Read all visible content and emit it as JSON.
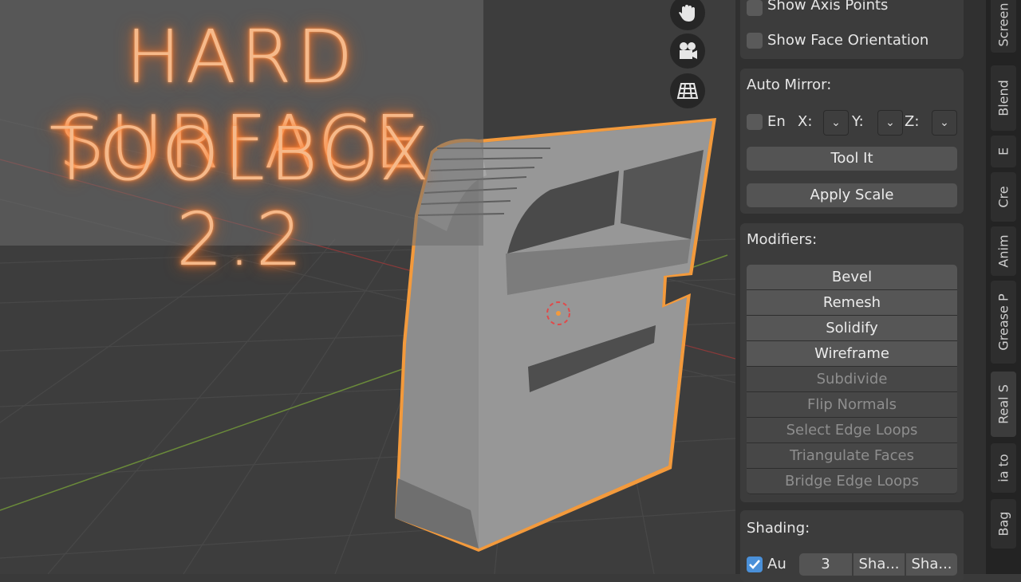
{
  "banner": {
    "line1": "HARD SURFACE",
    "line2": "TOOLBOX 2.2"
  },
  "viewport_icons": [
    "hand-icon",
    "camera-icon",
    "grid-icon"
  ],
  "overlays_panel": {
    "show_axis_points": "Show Axis Points",
    "show_face_orientation": "Show Face Orientation"
  },
  "auto_mirror": {
    "heading": "Auto Mirror:",
    "enable_label": "En",
    "x_label": "X:",
    "y_label": "Y:",
    "z_label": "Z:",
    "tool_it": "Tool It",
    "apply_scale": "Apply Scale"
  },
  "modifiers": {
    "heading": "Modifiers:",
    "items": [
      "Bevel",
      "Remesh",
      "Solidify",
      "Wireframe",
      "Subdivide",
      "Flip Normals",
      "Select Edge Loops",
      "Triangulate Faces",
      "Bridge Edge Loops"
    ]
  },
  "shading": {
    "heading": "Shading:",
    "auto_label": "Au",
    "value": "3",
    "btn1": "Sha...",
    "btn2": "Sha..."
  },
  "tabs": [
    "Screen",
    "Blend",
    "E",
    "Cre",
    "Anim",
    "Grease P",
    "Real S",
    "ia to",
    "Bag"
  ],
  "colors": {
    "accent_orange": "#f39a3c",
    "checkbox_blue": "#4a90d9",
    "title_glow": "#ff7a2a"
  }
}
